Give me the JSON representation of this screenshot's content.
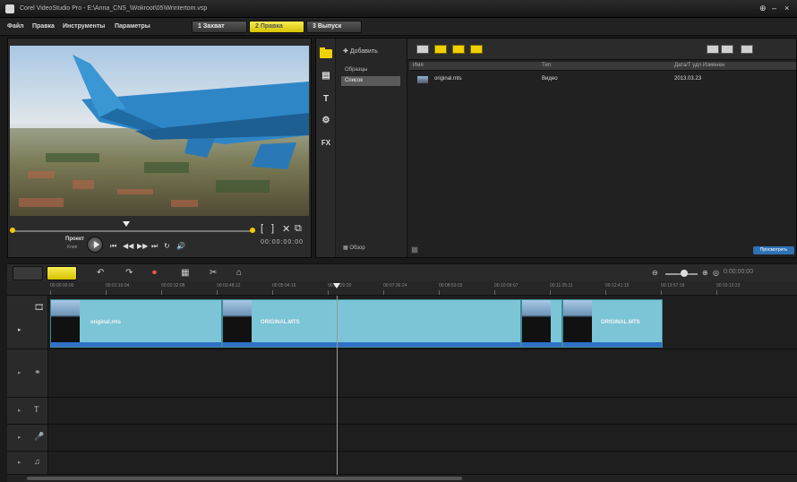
{
  "window": {
    "title": "Corel VideoStudio Pro - E:\\Anna_CNS_\\Wokroot\\05\\Wrintertom.vsp",
    "controls": [
      "⊕",
      "–",
      "×"
    ]
  },
  "menu": {
    "items": [
      "Файл",
      "Правка",
      "Инструменты",
      "Параметры"
    ],
    "steps": [
      {
        "num": "1",
        "label": "Захват"
      },
      {
        "num": "2",
        "label": "Правка"
      },
      {
        "num": "3",
        "label": "Выпуск"
      }
    ]
  },
  "preview": {
    "project_label": "Проект",
    "clip_label": "Клип",
    "timecode": "00:00:00:00",
    "side_controls": [
      "[",
      "]",
      "✕",
      "⧉"
    ],
    "transport": [
      "⏮",
      "◀◀",
      "▶▶",
      "⏭",
      "↻",
      "🔊"
    ]
  },
  "library": {
    "add_label": "Добавить",
    "folders": [
      "Образцы",
      "Список"
    ],
    "selected_folder_index": 1,
    "browse_label": "Обзор",
    "columns": [
      "Имя",
      "Тип",
      "Дата/Т удл Изменен"
    ],
    "files": [
      {
        "name": "original.mts",
        "type": "Видео",
        "date": "2013.03.23"
      }
    ],
    "status_label": "Просмотреть",
    "side_icons": [
      {
        "name": "media-icon",
        "glyph": ""
      },
      {
        "name": "instant-project-icon",
        "glyph": "▤"
      },
      {
        "name": "title-icon",
        "glyph": "T"
      },
      {
        "name": "transition-icon",
        "glyph": "⚙"
      },
      {
        "name": "fx-icon",
        "glyph": "FX"
      }
    ]
  },
  "timeline": {
    "tools": [
      "↶",
      "↷",
      "⏺",
      "▦",
      "✂",
      "⌂"
    ],
    "zoom_in": "⊕",
    "zoom_out": "⊖",
    "fit": "◎",
    "time_display": "0:00:00:00",
    "ruler_labels": [
      "00:00:00:00",
      "00:01:16:04",
      "00:02:32:08",
      "00:03:48:12",
      "00:05:04:16",
      "00:06:20:20",
      "00:07:36:24",
      "00:08:53:03",
      "00:10:09:07",
      "00:11:25:11",
      "00:12:41:15",
      "00:13:57:19",
      "00:15:13:23",
      "00:16:30:02",
      "00:17:46:06"
    ],
    "clips": [
      {
        "label": "original.mts"
      },
      {
        "label": "ORIGINAL.MTS"
      },
      {
        "label": ""
      },
      {
        "label": "ORIGINAL.MTS"
      }
    ],
    "tracks": [
      {
        "name": "video-track",
        "glyph": "🎞"
      },
      {
        "name": "overlay-track",
        "glyph": "⚭"
      },
      {
        "name": "title-track",
        "glyph": "T"
      },
      {
        "name": "voice-track",
        "glyph": "🎤"
      },
      {
        "name": "music-track",
        "glyph": "♫"
      }
    ]
  },
  "colors": {
    "accent_yellow": "#f3c800",
    "clip_fill": "#7cc5d6",
    "clip_audio": "#2f71c8",
    "background": "#1a1a1a"
  }
}
